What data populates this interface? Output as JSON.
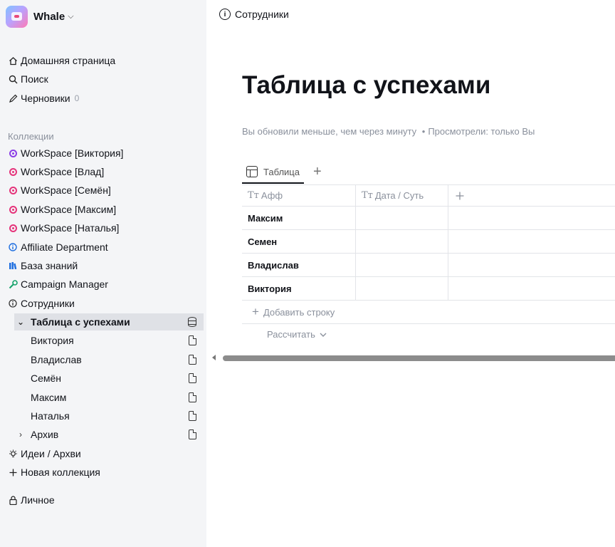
{
  "workspace": {
    "name": "Whale"
  },
  "sidebar": {
    "top_items": [
      {
        "label": "Домашняя страница",
        "icon": "home-icon"
      },
      {
        "label": "Поиск",
        "icon": "search-icon"
      },
      {
        "label": "Черновики",
        "icon": "pencil-icon",
        "count": "0"
      }
    ],
    "collections_label": "Коллекции",
    "collections": [
      {
        "label": "WorkSpace [Виктория]",
        "icon": "target-icon",
        "color": "#8b3fe6"
      },
      {
        "label": "WorkSpace [Влад]",
        "icon": "target-icon",
        "color": "#e5337a"
      },
      {
        "label": "WorkSpace [Семён]",
        "icon": "target-icon",
        "color": "#e5337a"
      },
      {
        "label": "WorkSpace [Максим]",
        "icon": "target-icon",
        "color": "#e5337a"
      },
      {
        "label": "WorkSpace [Наталья]",
        "icon": "target-icon",
        "color": "#e5337a"
      },
      {
        "label": "Affiliate Department",
        "icon": "info-icon",
        "color": "#1f6fe0"
      },
      {
        "label": "База знаний",
        "icon": "books-icon",
        "color": "#1f6fe0"
      },
      {
        "label": "Campaign Manager",
        "icon": "wrench-icon",
        "color": "#16a36b"
      },
      {
        "label": "Сотрудники",
        "icon": "info-icon",
        "color": "#333333"
      }
    ],
    "selected": {
      "label": "Таблица с успехами"
    },
    "children": [
      {
        "label": "Виктория"
      },
      {
        "label": "Владислав"
      },
      {
        "label": "Семён"
      },
      {
        "label": "Максим"
      },
      {
        "label": "Наталья"
      },
      {
        "label": "Архив"
      }
    ],
    "ideas": {
      "label": "Идеи / Архви"
    },
    "new_collection": {
      "label": "Новая коллекция"
    },
    "personal": {
      "label": "Личное"
    }
  },
  "header": {
    "breadcrumb": "Сотрудники"
  },
  "page": {
    "title": "Таблица с успехами",
    "meta_updated": "Вы обновили меньше, чем через минуту",
    "meta_separator": "•",
    "meta_viewed": "Просмотрели: только Вы"
  },
  "tabs": [
    {
      "label": "Таблица"
    }
  ],
  "table": {
    "columns": [
      "Афф",
      "Дата / Суть"
    ],
    "type_glyph": "Tт",
    "rows": [
      {
        "name": "Максим"
      },
      {
        "name": "Семен"
      },
      {
        "name": "Владислав"
      },
      {
        "name": "Виктория"
      }
    ],
    "add_row_label": "Добавить строку",
    "calc_label": "Рассчитать"
  }
}
